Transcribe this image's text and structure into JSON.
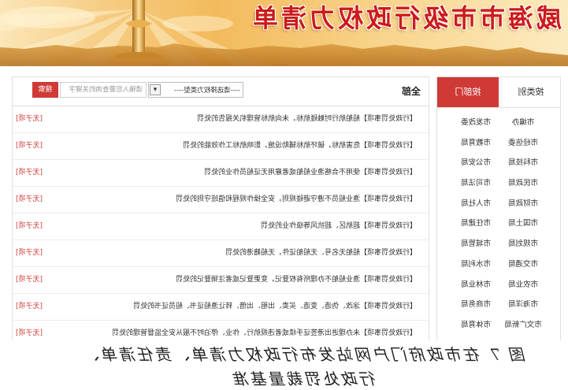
{
  "banner": {
    "title": "威海市市级行政权力清单"
  },
  "sidebar": {
    "tabs": [
      {
        "label": "按类别",
        "active": false
      },
      {
        "label": "按部门",
        "active": true
      }
    ],
    "departments": [
      "市编办",
      "市发改委",
      "市经信委",
      "市教育局",
      "市科技局",
      "市公安局",
      "市民政局",
      "市司法局",
      "市财政局",
      "市人社局",
      "市国土局",
      "市住建局",
      "市规划局",
      "市城管局",
      "市交通局",
      "市水利局",
      "市农业局",
      "市林业局",
      "市海洋局",
      "市商务局",
      "市文广新局",
      "市体育局"
    ]
  },
  "main": {
    "heading": "全部",
    "type_select": {
      "selected": "----请选择权力类型----"
    },
    "search": {
      "placeholder": "请输入您要查询的关键字",
      "button": "搜索"
    },
    "items": [
      {
        "title": "【行政处罚事项】船舶航行时触碰航标，未向航标管理机关报告的处罚",
        "sub": "[无子项]"
      },
      {
        "title": "【行政处罚事项】危害航标，破坏航标辅助设施，影响航标工作效能的处罚",
        "sub": "[无子项]"
      },
      {
        "title": "【行政处罚事项】使用不合格渔业船舶或者雇用无证船员作业的处罚",
        "sub": "[无子项]"
      },
      {
        "title": "【行政处罚事项】渔业船员不遵守避碰规则，安全操作规程和值班守则的处罚",
        "sub": "[无子项]"
      },
      {
        "title": "【行政处罚事项】超航区、超抗风等级作业的处罚",
        "sub": "[无子项]"
      },
      {
        "title": "【行政处罚事项】船舶无名号、无船舶证件，无船籍港的处罚",
        "sub": "[无子项]"
      },
      {
        "title": "【行政处罚事项】渔业船舶不办理所有权登记，变更登记或者注销登记的处罚",
        "sub": "[无子项]"
      },
      {
        "title": "【行政处罚事项】涂改、伪造、变造、买卖、出租、出借、转让渔船证书、船员证书的处罚",
        "sub": "[无子项]"
      },
      {
        "title": "【行政处罚事项】未办理进出港签证手续或者违规航行、作业、停泊时不服从安全监督管理的处罚",
        "sub": "[无子项]"
      }
    ]
  },
  "caption": {
    "line1": "图 7 在市政府门户网站发布行政权力清单、责任清单、",
    "line2": "行政处罚裁量基准"
  },
  "colors": {
    "accent": "#cf3a36",
    "title_red": "#cc1a1a",
    "banner_gold": "#f3ba5c"
  },
  "icons": {
    "select_arrow": "chevron-down-icon"
  }
}
